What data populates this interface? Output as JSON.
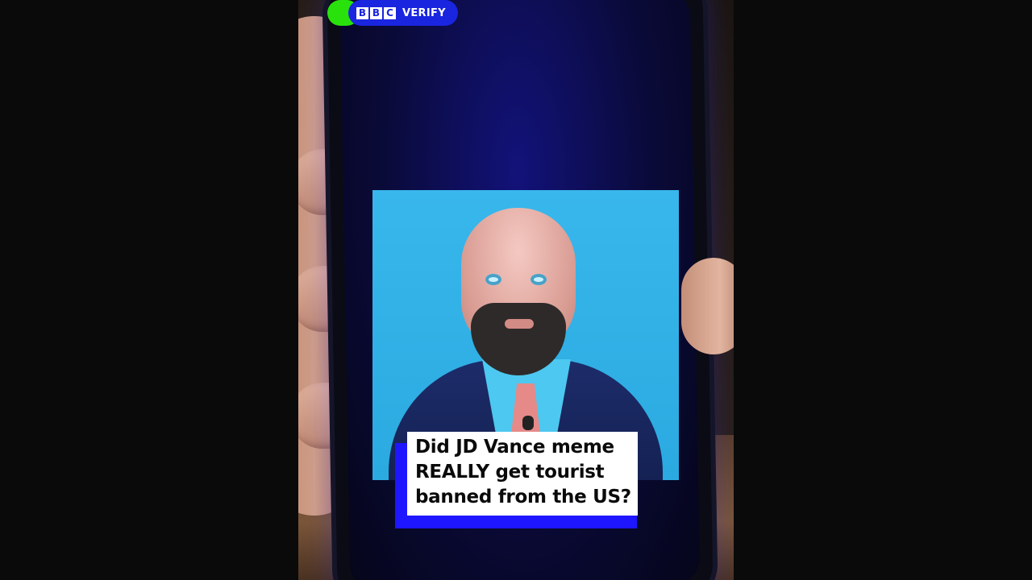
{
  "badge": {
    "logo_letters": [
      "B",
      "B",
      "C"
    ],
    "label": "VERIFY"
  },
  "caption": {
    "lines": [
      "Did JD Vance meme",
      "REALLY get tourist",
      "banned from the US?"
    ]
  },
  "colors": {
    "background": "#0a0a0a",
    "accent_blue": "#1a25e0",
    "badge_green": "#29e20c",
    "caption_shadow_blue": "#1e16ff",
    "caption_background": "#ffffff",
    "inner_video_sky": "#2aaae0"
  },
  "icons": {
    "badge_indicator": "green-dot-icon",
    "logo": "bbc-logo-icon"
  }
}
